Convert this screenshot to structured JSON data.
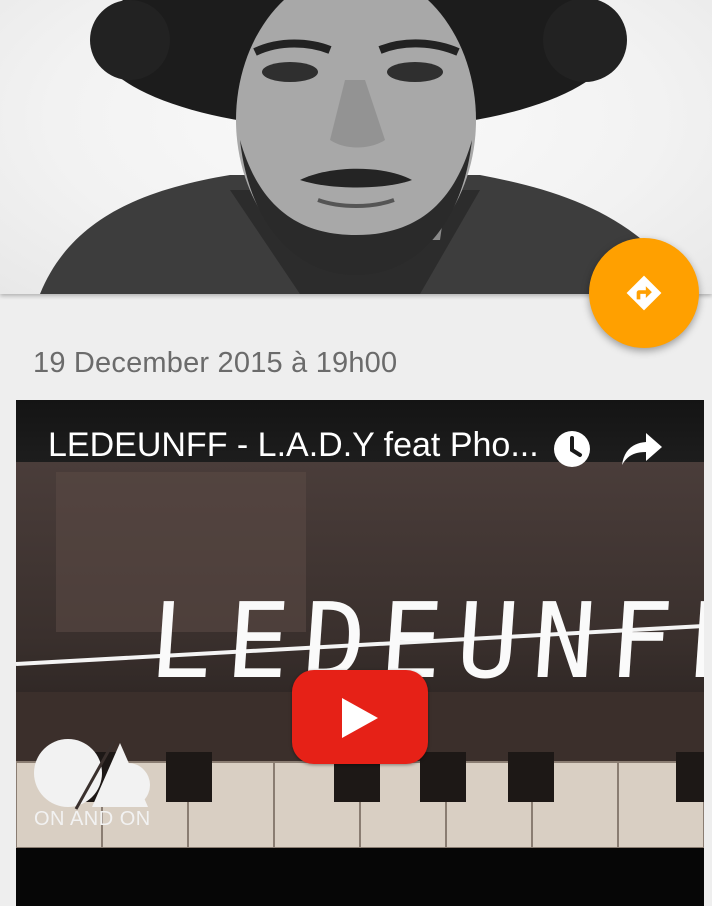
{
  "event": {
    "date_text": "19 December 2015 à 19h00"
  },
  "fab": {
    "icon": "directions-icon",
    "color": "#ffa000"
  },
  "video": {
    "title": "LEDEUNFF - L.A.D.Y feat Pho...",
    "thumbnail_text": "LEDEUNFF",
    "label_name": "ON AND ON",
    "play_color": "#e62117",
    "icons": [
      "clock-icon",
      "share-icon",
      "play-icon"
    ]
  }
}
